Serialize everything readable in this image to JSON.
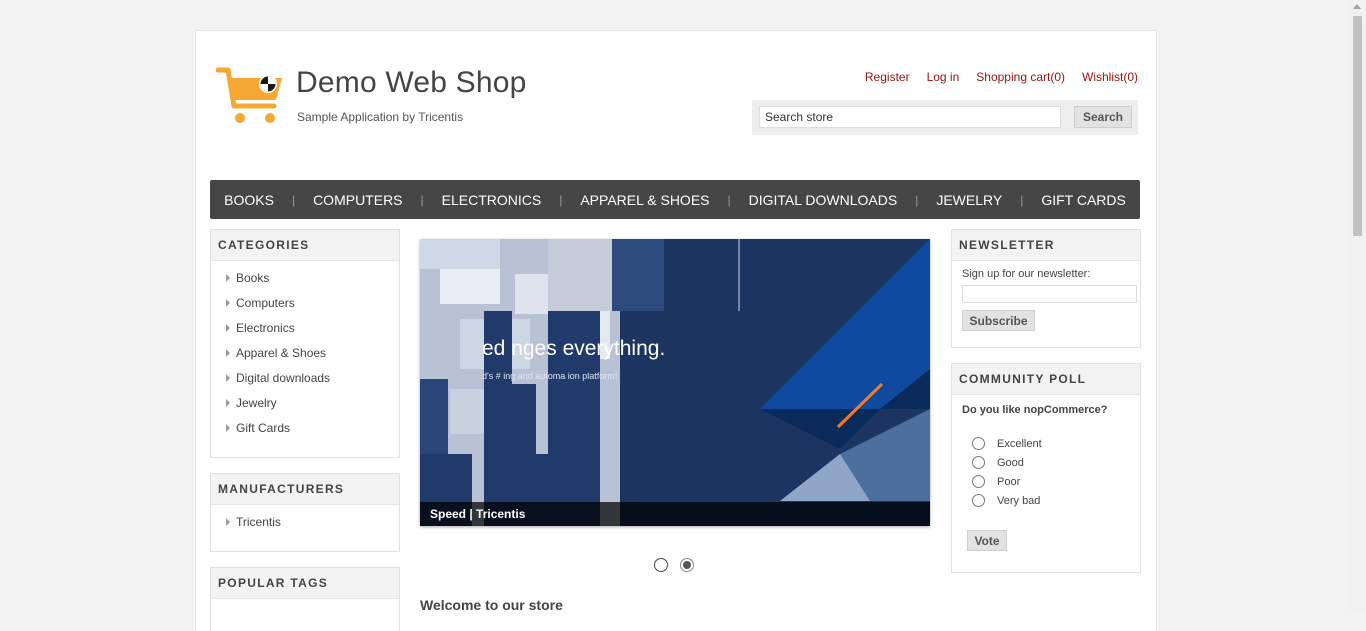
{
  "header": {
    "logo_title": "Demo Web Shop",
    "logo_subtitle": "Sample Application by Tricentis",
    "links": [
      "Register",
      "Log in",
      "Shopping cart(0)",
      "Wishlist(0)"
    ],
    "search": {
      "value": "Search store",
      "button_label": "Search"
    }
  },
  "top_menu": [
    "BOOKS",
    "COMPUTERS",
    "ELECTRONICS",
    "APPAREL & SHOES",
    "DIGITAL DOWNLOADS",
    "JEWELRY",
    "GIFT CARDS"
  ],
  "categories": {
    "title": "CATEGORIES",
    "items": [
      "Books",
      "Computers",
      "Electronics",
      "Apparel & Shoes",
      "Digital downloads",
      "Jewelry",
      "Gift Cards"
    ]
  },
  "manufacturers": {
    "title": "MANUFACTURERS",
    "items": [
      "Tricentis"
    ]
  },
  "popular_tags": {
    "title": "POPULAR TAGS"
  },
  "slider": {
    "headline": "ed    nges  everything.",
    "subline": "d's #       ing and automa   ion platform!",
    "caption": "Speed | Tricentis",
    "active_dot": 1,
    "dot_count": 2
  },
  "welcome_title": "Welcome to our store",
  "newsletter": {
    "title": "NEWSLETTER",
    "label": "Sign up for our newsletter:",
    "button_label": "Subscribe"
  },
  "poll": {
    "title": "COMMUNITY POLL",
    "question": "Do you like nopCommerce?",
    "options": [
      "Excellent",
      "Good",
      "Poor",
      "Very bad"
    ],
    "button_label": "Vote"
  },
  "colors": {
    "link": "#991111",
    "menu_bg": "#464646",
    "logo_orange": "#f5a833"
  }
}
